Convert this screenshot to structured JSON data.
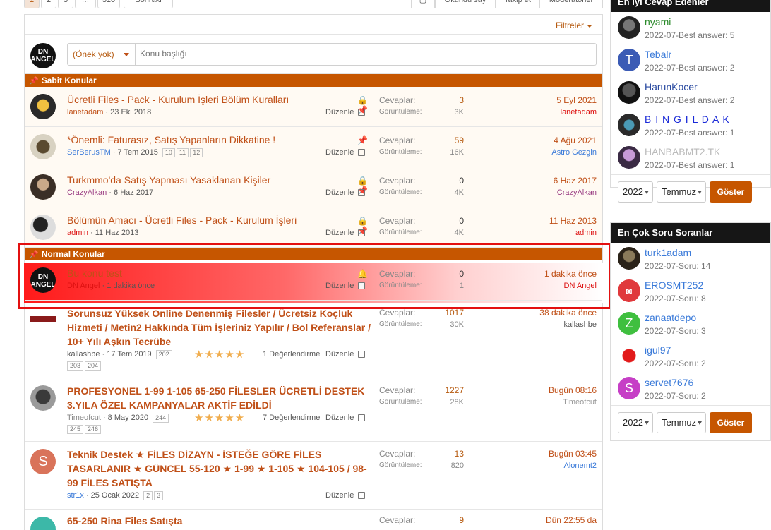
{
  "pager": {
    "pages": [
      "1",
      "2",
      "3",
      "…",
      "310"
    ],
    "goto": "Sonraki"
  },
  "toolbar": {
    "btn1": "Okundu say",
    "btn2": "Takip et",
    "btn3": "Moderatörler"
  },
  "filters": "Filtreler",
  "new_thread": {
    "avatar": "DN ANGEL",
    "prefix": "(Önek yok)",
    "placeholder": "Konu başlığı"
  },
  "sections": {
    "sticky": "Sabit Konular",
    "normal": "Normal Konular"
  },
  "labels": {
    "replies": "Cevaplar:",
    "views": "Görüntüleme:",
    "edit": "Düzenle"
  },
  "sticky_threads": [
    {
      "title": "Ücretli Files - Pack - Kurulum İşleri Bölüm Kuralları",
      "author": "lanetadam",
      "date": "23 Eki 2018",
      "replies": "3",
      "views": "3K",
      "last_date": "5 Eyl 2021",
      "last_user": "lanetadam",
      "pages": []
    },
    {
      "title": "*Önemli: Faturasız, Satış Yapanların Dikkatine !",
      "author": "SerBerusTM",
      "date": "7 Tem 2015",
      "replies": "59",
      "views": "16K",
      "last_date": "4 Ağu 2021",
      "last_user": "Astro Gezgin",
      "pages": [
        "10",
        "11",
        "12"
      ]
    },
    {
      "title": "Turkmmo'da Satış Yapması Yasaklanan Kişiler",
      "author": "CrazyAlkan",
      "date": "6 Haz 2017",
      "replies": "0",
      "views": "4K",
      "last_date": "6 Haz 2017",
      "last_user": "CrazyAlkan",
      "pages": []
    },
    {
      "title": "Bölümün Amacı - Ücretli Files - Pack - Kurulum İşleri",
      "author": "admin",
      "date": "11 Haz 2013",
      "replies": "0",
      "views": "4K",
      "last_date": "11 Haz 2013",
      "last_user": "admin",
      "pages": []
    }
  ],
  "highlight_thread": {
    "title": "Bu konu test",
    "author": "DN Angel",
    "date": "1 dakika önce",
    "replies": "0",
    "views": "1",
    "last_date": "1 dakika önce",
    "last_user": "DN Angel"
  },
  "normal_threads": [
    {
      "title": "Sorunsuz Yüksek Online Denenmiş Filesler / Ücretsiz Koçluk Hizmeti / Metin2 Hakkında Tüm İşleriniz Yapılır / Bol Referanslar / 10+ Yılı Aşkın Tecrübe",
      "author": "kallashbe",
      "date": "17 Tem 2019",
      "pages": [
        "202",
        "203",
        "204"
      ],
      "rating": "1 Değerlendirme",
      "stars": 5,
      "replies": "1017",
      "views": "30K",
      "last_date": "38 dakika önce",
      "last_user": "kallashbe"
    },
    {
      "title": "PROFESYONEL 1-99 1-105 65-250 FİLESLER ÜCRETLİ DESTEK 3.YILA ÖZEL KAMPANYALAR AKTİF EDİLDİ",
      "author": "Timeofcut",
      "date": "8 May 2020",
      "pages": [
        "244",
        "245",
        "246"
      ],
      "rating": "7 Değerlendirme",
      "stars": 5,
      "replies": "1227",
      "views": "28K",
      "last_date": "Bugün 08:16",
      "last_user": "Timeofcut"
    },
    {
      "title": "Teknik Destek ★ FİLES DİZAYN - İSTEĞE GÖRE FİLES TASARLANIR ★ GÜNCEL 55-120 ★ 1-99 ★ 1-105 ★ 104-105 / 98-99 FİLES SATIŞTA",
      "author": "str1x",
      "date": "25 Ocak 2022",
      "pages": [
        "2",
        "3"
      ],
      "replies": "13",
      "views": "820",
      "last_date": "Bugün 03:45",
      "last_user": "Alonemt2",
      "avatar_letter": "S"
    },
    {
      "title": "65-250 Rina Files Satışta",
      "replies": "9",
      "last_date": "Dün 22:55 da"
    }
  ],
  "widget_answers": {
    "title": "En İyi Cevap Edenler",
    "items": [
      {
        "name": "nyami",
        "info": "2022-07-Best answer: 5"
      },
      {
        "name": "Tebalr",
        "info": "2022-07-Best answer: 2",
        "letter": "T"
      },
      {
        "name": "HarunKocer",
        "info": "2022-07-Best answer: 2"
      },
      {
        "name": "B I N G I L D A K",
        "info": "2022-07-Best answer: 1"
      },
      {
        "name": "HANBABMT2.TK",
        "info": "2022-07-Best answer: 1"
      }
    ],
    "year": "2022",
    "month": "Temmuz",
    "button": "Göster"
  },
  "widget_questions": {
    "title": "En Çok Soru Soranlar",
    "items": [
      {
        "name": "turk1adam",
        "info": "2022-07-Soru: 14"
      },
      {
        "name": "EROSMT252",
        "info": "2022-07-Soru: 8"
      },
      {
        "name": "zanaatdepo",
        "info": "2022-07-Soru: 3",
        "letter": "Z"
      },
      {
        "name": "igul97",
        "info": "2022-07-Soru: 2"
      },
      {
        "name": "servet7676",
        "info": "2022-07-Soru: 2",
        "letter": "S"
      }
    ],
    "year": "2022",
    "month": "Temmuz",
    "button": "Göster"
  },
  "colors": {
    "accent": "#c65600",
    "link": "#c05018",
    "highlight": "#e31010"
  }
}
